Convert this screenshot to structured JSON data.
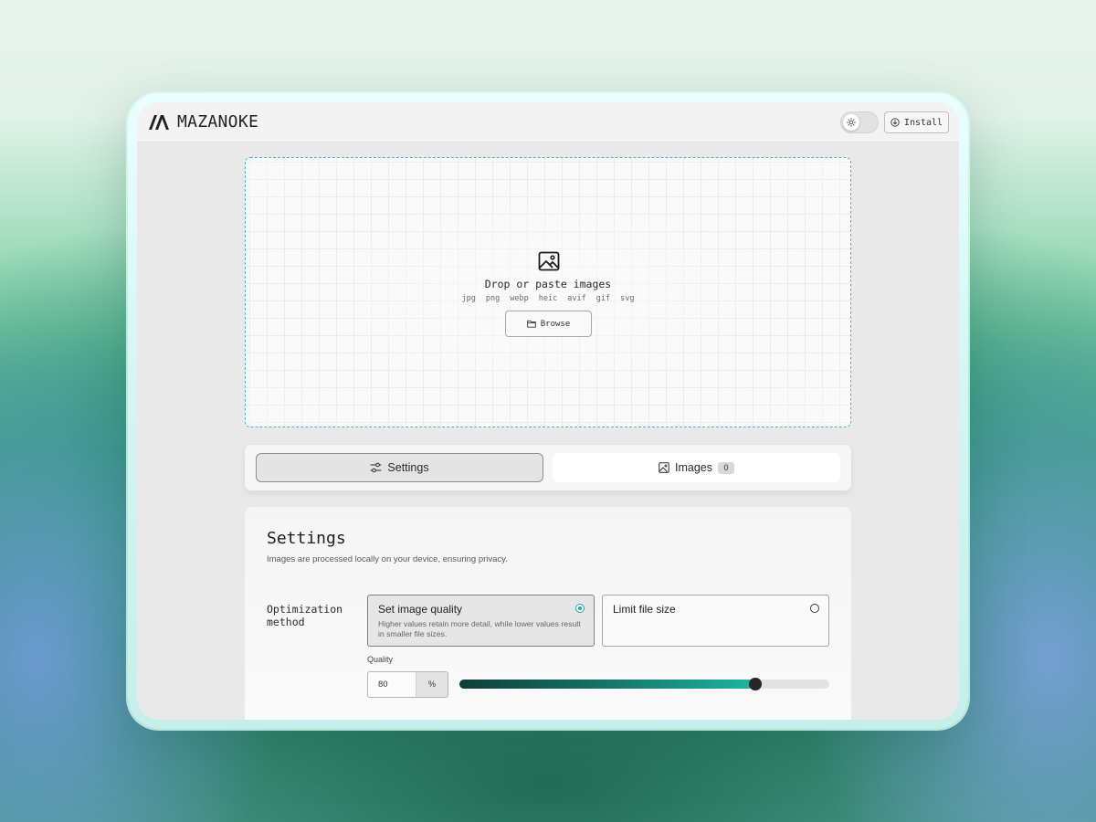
{
  "app": {
    "name": "MAZANOKE",
    "install_label": "Install"
  },
  "dropzone": {
    "title": "Drop or paste images",
    "formats": [
      "jpg",
      "png",
      "webp",
      "heic",
      "avif",
      "gif",
      "svg"
    ],
    "browse_label": "Browse"
  },
  "tabs": {
    "settings_label": "Settings",
    "images_label": "Images",
    "images_count": "0",
    "active": "settings"
  },
  "settings": {
    "title": "Settings",
    "subtitle": "Images are processed locally on your device, ensuring privacy.",
    "method_label": "Optimization method",
    "options": [
      {
        "title": "Set image quality",
        "description": "Higher values retain more detail, while lower values result in smaller file sizes.",
        "selected": true
      },
      {
        "title": "Limit file size",
        "description": "",
        "selected": false
      }
    ],
    "quality_label": "Quality",
    "quality_value": "80",
    "quality_unit": "%",
    "quality_slider_fraction": 0.8
  },
  "colors": {
    "accent": "#1ea89a",
    "dropzone_border": "#4fb5ad",
    "slider_start": "#0f3e36",
    "slider_end": "#20b4a0"
  },
  "icons": {
    "logo": "mazanoke-logo-icon",
    "theme": "sun-icon",
    "install": "download-circle-icon",
    "dropzone": "image-icon",
    "browse": "folder-icon",
    "settings_tab": "sliders-icon",
    "images_tab": "image-icon"
  }
}
